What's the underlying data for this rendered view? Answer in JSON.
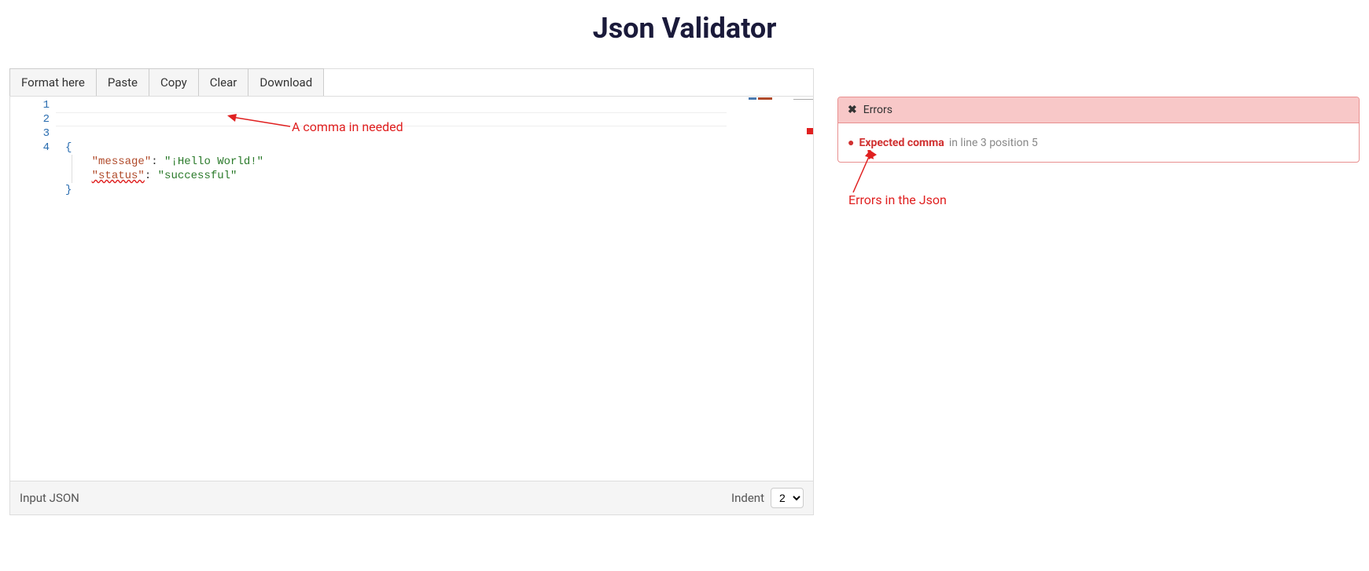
{
  "title": "Json Validator",
  "toolbar": {
    "format": "Format here",
    "paste": "Paste",
    "copy": "Copy",
    "clear": "Clear",
    "download": "Download"
  },
  "editor": {
    "lines": [
      {
        "n": "1",
        "tokens": [
          {
            "t": "{",
            "c": "brace"
          }
        ]
      },
      {
        "n": "2",
        "tokens": [
          {
            "t": "    ",
            "c": ""
          },
          {
            "t": "\"message\"",
            "c": "key"
          },
          {
            "t": ": ",
            "c": "colon"
          },
          {
            "t": "\"¡Hello World!\"",
            "c": "string"
          }
        ]
      },
      {
        "n": "3",
        "tokens": [
          {
            "t": "    ",
            "c": ""
          },
          {
            "t": "\"status\"",
            "c": "key err-underline"
          },
          {
            "t": ": ",
            "c": "colon"
          },
          {
            "t": "\"successful\"",
            "c": "string"
          }
        ]
      },
      {
        "n": "4",
        "tokens": [
          {
            "t": "}",
            "c": "brace"
          }
        ]
      }
    ]
  },
  "footer": {
    "left": "Input JSON",
    "indent_label": "Indent",
    "indent_value": "2"
  },
  "errors": {
    "header": "Errors",
    "items": [
      {
        "bullet": "●",
        "main": "Expected comma",
        "detail": "in line 3 position 5"
      }
    ]
  },
  "annotations": {
    "a1": "A comma in needed",
    "a2": "Errors in the Json"
  }
}
